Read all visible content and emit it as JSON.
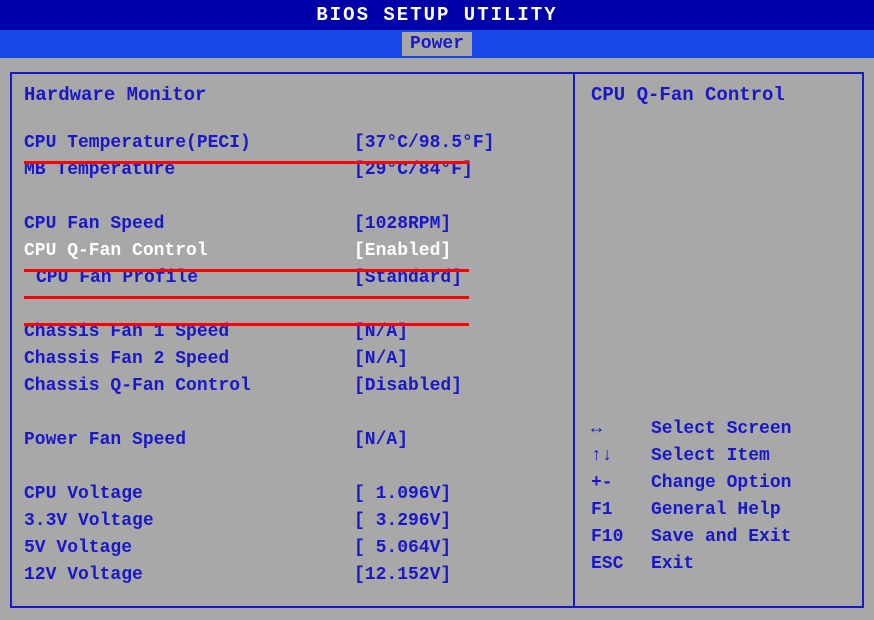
{
  "header": {
    "title": "BIOS SETUP UTILITY",
    "tab": "Power"
  },
  "leftPanel": {
    "title": "Hardware Monitor",
    "rows": [
      {
        "label": "CPU Temperature(PECI)",
        "value": "[37°C/98.5°F]"
      },
      {
        "label": "MB Temperature",
        "value": "[29°C/84°F]"
      },
      {
        "type": "spacer"
      },
      {
        "label": "CPU Fan Speed",
        "value": "[1028RPM]"
      },
      {
        "label": "CPU Q-Fan Control",
        "value": "[Enabled]",
        "selected": true
      },
      {
        "label": "CPU Fan Profile",
        "value": "[Standard]",
        "indent": true
      },
      {
        "type": "spacer"
      },
      {
        "label": "Chassis Fan 1 Speed",
        "value": "[N/A]"
      },
      {
        "label": "Chassis Fan 2 Speed",
        "value": "[N/A]"
      },
      {
        "label": "Chassis Q-Fan Control",
        "value": "[Disabled]"
      },
      {
        "type": "spacer"
      },
      {
        "label": "Power Fan Speed",
        "value": "[N/A]"
      },
      {
        "type": "spacer"
      },
      {
        "label": "CPU   Voltage",
        "value": "[ 1.096V]"
      },
      {
        "label": "3.3V  Voltage",
        "value": "[ 3.296V]"
      },
      {
        "label": "5V    Voltage",
        "value": "[ 5.064V]"
      },
      {
        "label": "12V   Voltage",
        "value": "[12.152V]"
      }
    ]
  },
  "rightPanel": {
    "title": "CPU Q-Fan Control",
    "help": [
      {
        "key": "↔",
        "desc": "Select Screen"
      },
      {
        "key": "↑↓",
        "desc": "Select Item"
      },
      {
        "key": "+-",
        "desc": "Change Option"
      },
      {
        "key": "F1",
        "desc": "General Help"
      },
      {
        "key": "F10",
        "desc": "Save and Exit"
      },
      {
        "key": "ESC",
        "desc": "Exit"
      }
    ]
  }
}
